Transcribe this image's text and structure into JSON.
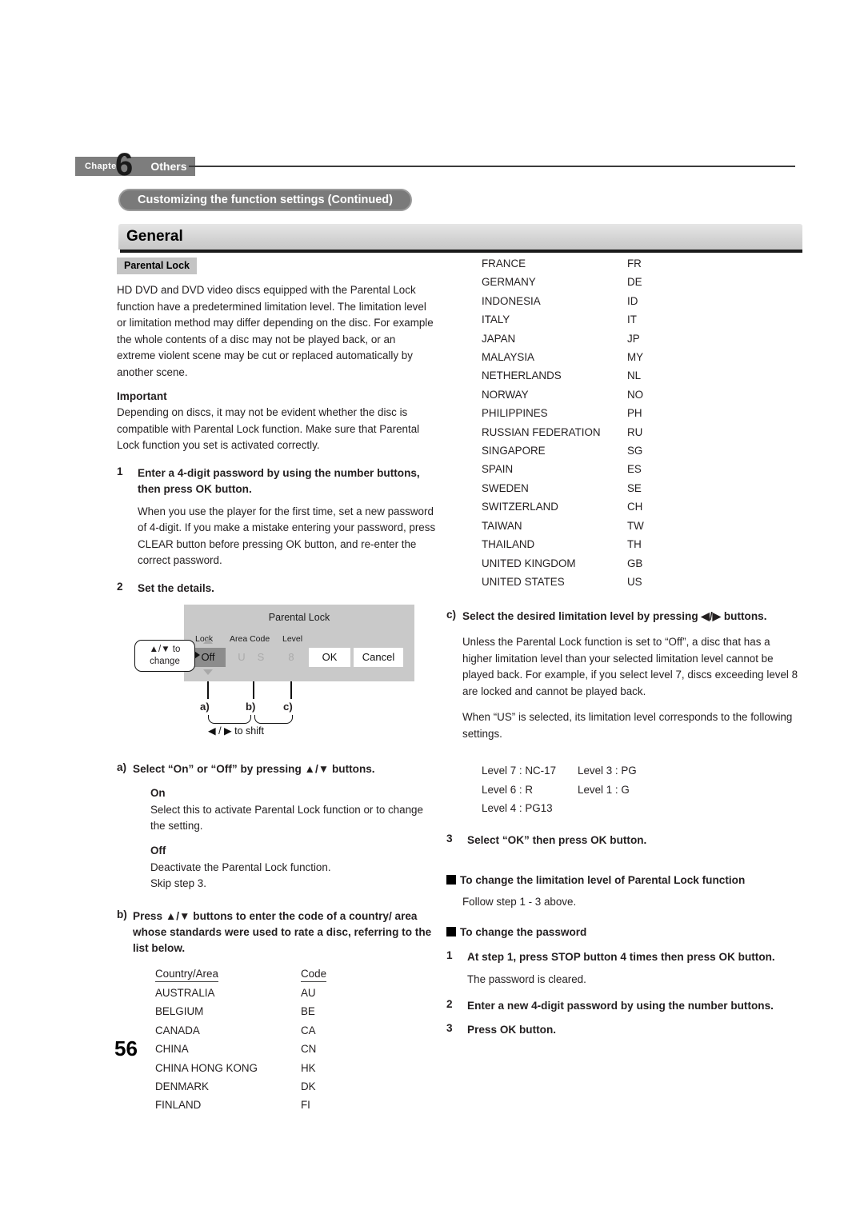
{
  "header": {
    "chapter_word": "Chapter",
    "chapter_number": "6",
    "chapter_name": "Others",
    "section_pill": "Customizing the function settings (Continued)",
    "section_bar_title": "General"
  },
  "page_number": "56",
  "left": {
    "badge": "Parental Lock",
    "intro": "HD DVD and DVD video discs equipped with the Parental Lock function have a predetermined limitation level. The limitation level or limitation method may differ depending on the disc. For example the whole contents of a disc may not be played back, or an extreme violent scene may be cut or replaced automatically by another scene.",
    "important_heading": "Important",
    "important_text": "Depending on discs, it may not be evident whether the disc is compatible with Parental Lock function. Make sure that Parental Lock function you set is activated correctly.",
    "step1": {
      "num": "1",
      "title": "Enter a 4-digit password by using the number buttons, then press OK button.",
      "note": "When you use the player for the first time, set a new password of 4-digit. If you make a mistake entering your password, press CLEAR button before pressing OK button, and re-enter the correct password."
    },
    "step2": {
      "num": "2",
      "title": "Set the details."
    },
    "diagram": {
      "title": "Parental Lock",
      "label_lock": "Lock",
      "label_area_code": "Area Code",
      "label_level": "Level",
      "value_lock": "Off",
      "value_area_1": "U",
      "value_area_2": "S",
      "value_level": "8",
      "button_ok": "OK",
      "button_cancel": "Cancel",
      "callout": "▲/▼ to change",
      "callout_line1": "▲/▼ to",
      "callout_line2": "change",
      "marker_a": "a)",
      "marker_b": "b)",
      "marker_c": "c)",
      "shift_label": "◀ / ▶ to shift"
    },
    "item_a": {
      "letter": "a)",
      "title": "Select “On” or “Off” by pressing ▲/▼ buttons.",
      "on_heading": "On",
      "on_text": "Select this to activate Parental Lock function or to change the setting.",
      "off_heading": "Off",
      "off_text_line1": "Deactivate the Parental Lock function.",
      "off_text_line2": "Skip step 3."
    },
    "item_b": {
      "letter": "b)",
      "title": "Press ▲/▼ buttons to enter the code of a country/ area whose standards were used to rate a disc, referring to the list below."
    },
    "country_table": {
      "header_name": "Country/Area",
      "header_code": "Code",
      "rows": [
        {
          "name": "AUSTRALIA",
          "code": "AU"
        },
        {
          "name": "BELGIUM",
          "code": "BE"
        },
        {
          "name": "CANADA",
          "code": "CA"
        },
        {
          "name": "CHINA",
          "code": "CN"
        },
        {
          "name": "CHINA HONG KONG",
          "code": "HK"
        },
        {
          "name": "DENMARK",
          "code": "DK"
        },
        {
          "name": "FINLAND",
          "code": "FI"
        }
      ]
    }
  },
  "right": {
    "country_table_rows": [
      {
        "name": "FRANCE",
        "code": "FR"
      },
      {
        "name": "GERMANY",
        "code": "DE"
      },
      {
        "name": "INDONESIA",
        "code": "ID"
      },
      {
        "name": "ITALY",
        "code": "IT"
      },
      {
        "name": "JAPAN",
        "code": "JP"
      },
      {
        "name": "MALAYSIA",
        "code": "MY"
      },
      {
        "name": "NETHERLANDS",
        "code": "NL"
      },
      {
        "name": "NORWAY",
        "code": "NO"
      },
      {
        "name": "PHILIPPINES",
        "code": "PH"
      },
      {
        "name": "RUSSIAN FEDERATION",
        "code": "RU"
      },
      {
        "name": "SINGAPORE",
        "code": "SG"
      },
      {
        "name": "SPAIN",
        "code": "ES"
      },
      {
        "name": "SWEDEN",
        "code": "SE"
      },
      {
        "name": "SWITZERLAND",
        "code": "CH"
      },
      {
        "name": "TAIWAN",
        "code": "TW"
      },
      {
        "name": "THAILAND",
        "code": "TH"
      },
      {
        "name": "UNITED KINGDOM",
        "code": "GB"
      },
      {
        "name": "UNITED STATES",
        "code": "US"
      }
    ],
    "item_c": {
      "letter": "c)",
      "title": "Select the desired limitation level by pressing ◀/▶ buttons.",
      "para1": "Unless the Parental Lock function is set to “Off”, a disc that has a higher limitation level than your selected limitation level cannot be played back. For example, if you select level 7, discs exceeding level 8 are locked and cannot be played back.",
      "para2": "When “US” is selected, its limitation level corresponds to the following settings."
    },
    "levels": [
      {
        "left": "Level 7 : NC-17",
        "right": "Level 3 : PG"
      },
      {
        "left": "Level 6 : R",
        "right": "Level 1 : G"
      },
      {
        "left": "Level 4 : PG13",
        "right": ""
      }
    ],
    "step3": {
      "num": "3",
      "title": "Select “OK” then press OK button."
    },
    "change_level": {
      "heading": "To change the limitation level of Parental Lock function",
      "text": "Follow step 1 - 3 above."
    },
    "change_password": {
      "heading": "To change the password",
      "step1_num": "1",
      "step1_title": "At step 1, press STOP button 4 times then press OK button.",
      "step1_note": "The password is cleared.",
      "step2_num": "2",
      "step2_title": "Enter a new 4-digit password by using the number buttons.",
      "step3_num": "3",
      "step3_title": "Press OK button."
    }
  }
}
